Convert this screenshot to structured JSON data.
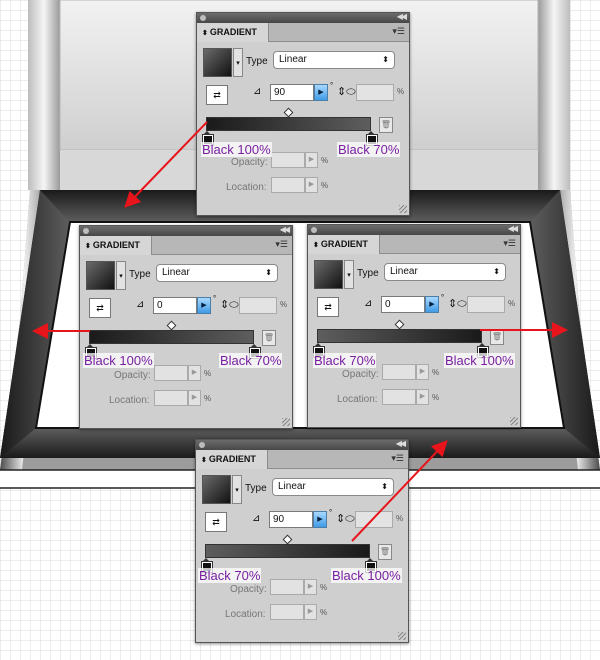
{
  "panel_title": "GRADIENT",
  "type_label": "Type",
  "opacity_label": "Opacity:",
  "location_label": "Location:",
  "percent": "%",
  "degree": "°",
  "panels": [
    {
      "type_value": "Linear",
      "angle": "90",
      "stops": [
        "Black 100%",
        "Black 70%"
      ],
      "gradient": {
        "from": "#1a1a1a",
        "to": "#5e5e5e"
      }
    },
    {
      "type_value": "Linear",
      "angle": "0",
      "stops": [
        "Black 100%",
        "Black 70%"
      ],
      "gradient": {
        "from": "#1a1a1a",
        "to": "#5e5e5e"
      }
    },
    {
      "type_value": "Linear",
      "angle": "0",
      "stops": [
        "Black 70%",
        "Black 100%"
      ],
      "gradient": {
        "from": "#5e5e5e",
        "to": "#1a1a1a"
      }
    },
    {
      "type_value": "Linear",
      "angle": "90",
      "stops": [
        "Black 70%",
        "Black 100%"
      ],
      "gradient": {
        "from": "#5e5e5e",
        "to": "#1a1a1a"
      }
    }
  ],
  "colors": {
    "arrow": "#e8141b",
    "caption": "#7a1fa2",
    "frame_dark": "#1c1c1c",
    "panel_bg": "#cfcfcf"
  }
}
